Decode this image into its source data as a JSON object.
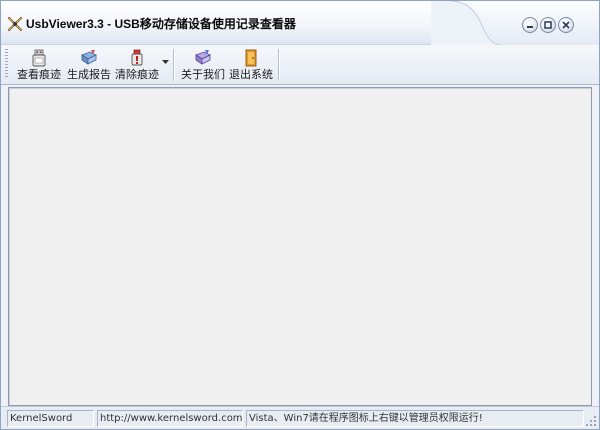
{
  "window": {
    "title": "UsbViewer3.3 - USB移动存储设备使用记录查看器"
  },
  "title_buttons": [
    {
      "name": "minimize-button",
      "icon": "minimize-icon"
    },
    {
      "name": "maximize-button",
      "icon": "maximize-icon"
    },
    {
      "name": "close-button",
      "icon": "close-icon"
    }
  ],
  "toolbar": {
    "view_traces": {
      "label": "查看痕迹",
      "icon": "usb-drive-icon"
    },
    "generate_report": {
      "label": "生成报告",
      "icon": "report-icon"
    },
    "clear_traces": {
      "label": "清除痕迹",
      "icon": "clear-usb-icon"
    },
    "about_us": {
      "label": "关于我们",
      "icon": "about-icon"
    },
    "exit_system": {
      "label": "退出系统",
      "icon": "exit-door-icon"
    }
  },
  "statusbar": {
    "author": "KernelSword",
    "website": "http://www.kernelsword.com",
    "tip": "Vista、Win7请在程序图标上右键以管理员权限运行!"
  },
  "colors": {
    "title_bg": "#f3f6fb",
    "toolbar_bg": "#e5eaf3",
    "content_bg": "#f0f0f0",
    "status_bg": "#e8ecf3"
  }
}
